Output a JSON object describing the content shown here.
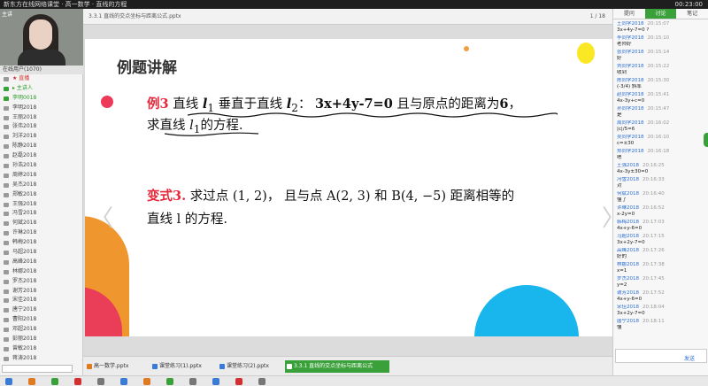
{
  "topbar": {
    "title": "新东方在线网络课堂 · 高一数学 · 直线的方程",
    "right": "00:23:00"
  },
  "left": {
    "webcam_tag": "主讲",
    "users_header": "在线用户(1070)",
    "users": [
      {
        "name": "★ 直播",
        "style": "red"
      },
      {
        "name": "▸ 主讲人",
        "style": "green"
      },
      {
        "name": "李明0018",
        "style": "green"
      },
      {
        "name": "李明2018",
        "style": ""
      },
      {
        "name": "王丽2018",
        "style": ""
      },
      {
        "name": "张伟2018",
        "style": ""
      },
      {
        "name": "刘洋2018",
        "style": ""
      },
      {
        "name": "陈静2018",
        "style": ""
      },
      {
        "name": "赵磊2018",
        "style": ""
      },
      {
        "name": "孙浩2018",
        "style": ""
      },
      {
        "name": "周婷2018",
        "style": ""
      },
      {
        "name": "吴杰2018",
        "style": ""
      },
      {
        "name": "郑敏2018",
        "style": ""
      },
      {
        "name": "王强2018",
        "style": ""
      },
      {
        "name": "冯雪2018",
        "style": ""
      },
      {
        "name": "何斌2018",
        "style": ""
      },
      {
        "name": "许琳2018",
        "style": ""
      },
      {
        "name": "韩梅2018",
        "style": ""
      },
      {
        "name": "马超2018",
        "style": ""
      },
      {
        "name": "高峰2018",
        "style": ""
      },
      {
        "name": "林娜2018",
        "style": ""
      },
      {
        "name": "罗杰2018",
        "style": ""
      },
      {
        "name": "谢芳2018",
        "style": ""
      },
      {
        "name": "宋佳2018",
        "style": ""
      },
      {
        "name": "唐宁2018",
        "style": ""
      },
      {
        "name": "曹阳2018",
        "style": ""
      },
      {
        "name": "邓超2018",
        "style": ""
      },
      {
        "name": "彭丽2018",
        "style": ""
      },
      {
        "name": "曾敏2018",
        "style": ""
      },
      {
        "name": "蒋涛2018",
        "style": ""
      }
    ]
  },
  "slide": {
    "tab_label": "3.3.1 直线的交点坐标与距离公式.pptx",
    "tab_right": "1 / 18",
    "title": "例题讲解",
    "ex1_label": "例3",
    "ex1_a": " 直线 ",
    "ex1_l1": "l",
    "ex1_sub1": "1",
    "ex1_b": " 垂直于直线 ",
    "ex1_l2": "l",
    "ex1_sub2": "2",
    "ex1_c": "： ",
    "ex1_eq": "3x+4y-7=0",
    "ex1_d": " 且与原点的距离为",
    "ex1_dist": "6",
    "ex1_e": "，",
    "ex1_line2a": "求直线 ",
    "ex1_line2l": "l",
    "ex1_line2sub": "1",
    "ex1_line2b": "的方程.",
    "ex2_label": "变式3.",
    "ex2_text": " 求过点 (1, 2)， 且与点 A(2, 3) 和 B(4, −5) 距离相等的",
    "ex2_line2": "直线 l 的方程.",
    "nav_prev": "〈",
    "nav_next": "〉"
  },
  "thumbs": [
    {
      "label": "高一数学.pptx",
      "color": "#e07a20",
      "active": false
    },
    {
      "label": "课堂练习(1).pptx",
      "color": "#3a7bd5",
      "active": false
    },
    {
      "label": "课堂练习(2).pptx",
      "color": "#3a7bd5",
      "active": false
    },
    {
      "label": "3.3.1 直线的交点坐标与距离公式",
      "color": "#ffffff",
      "active": true
    }
  ],
  "right": {
    "tabs": [
      "提问",
      "讨论",
      "笔记"
    ],
    "active_tab": 1,
    "messages": [
      {
        "name": "王同学2018",
        "time": "20:15:07",
        "body": "3x+4y-7=0 ?"
      },
      {
        "name": "李同学2018",
        "time": "20:15:10",
        "body": "老师好"
      },
      {
        "name": "张同学2018",
        "time": "20:15:14",
        "body": "好"
      },
      {
        "name": "刘同学2018",
        "time": "20:15:22",
        "body": "收到"
      },
      {
        "name": "陈同学2018",
        "time": "20:15:30",
        "body": "(-3/4) 斜率"
      },
      {
        "name": "赵同学2018",
        "time": "20:15:41",
        "body": "4x-3y+c=0"
      },
      {
        "name": "孙同学2018",
        "time": "20:15:47",
        "body": "是"
      },
      {
        "name": "周同学2018",
        "time": "20:16:02",
        "body": "|c|/5=6"
      },
      {
        "name": "吴同学2018",
        "time": "20:16:10",
        "body": "c=±30"
      },
      {
        "name": "郑同学2018",
        "time": "20:16:18",
        "body": "嗯"
      },
      {
        "name": "王强2018",
        "time": "20:16:25",
        "body": "4x-3y±30=0"
      },
      {
        "name": "冯雪2018",
        "time": "20:16:33",
        "body": "对"
      },
      {
        "name": "何斌2018",
        "time": "20:16:40",
        "body": "懂了"
      },
      {
        "name": "许琳2018",
        "time": "20:16:52",
        "body": "x-2y=0"
      },
      {
        "name": "韩梅2018",
        "time": "20:17:03",
        "body": "4x+y-6=0"
      },
      {
        "name": "马超2018",
        "time": "20:17:15",
        "body": "3x+2y-7=0"
      },
      {
        "name": "高峰2018",
        "time": "20:17:26",
        "body": "好的"
      },
      {
        "name": "林娜2018",
        "time": "20:17:38",
        "body": "x=1"
      },
      {
        "name": "罗杰2018",
        "time": "20:17:45",
        "body": "y=2"
      },
      {
        "name": "谢芳2018",
        "time": "20:17:52",
        "body": "4x+y-6=0"
      },
      {
        "name": "宋佳2018",
        "time": "20:18:04",
        "body": "3x+2y-7=0"
      },
      {
        "name": "唐宁2018",
        "time": "20:18:11",
        "body": "懂"
      }
    ],
    "send_label": "发送"
  }
}
